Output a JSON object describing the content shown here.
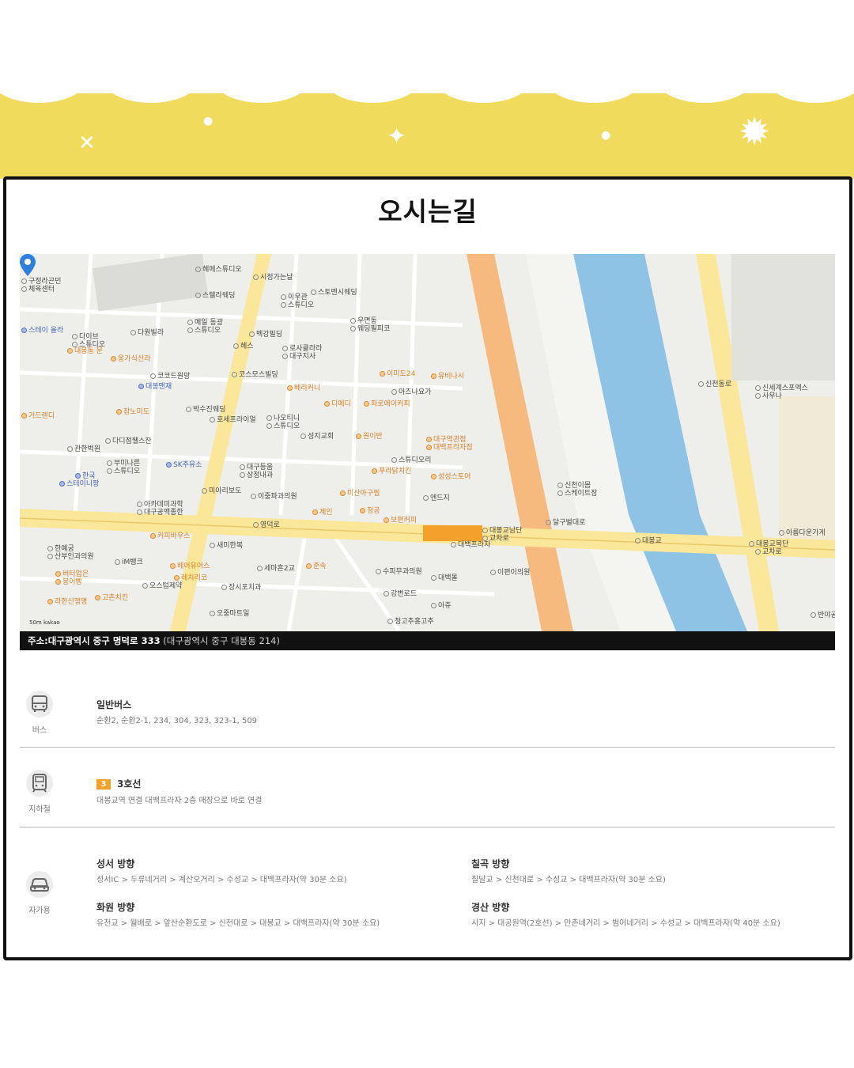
{
  "page": {
    "title": "오시는길"
  },
  "map": {
    "labels": [
      {
        "t": "구정라곤민",
        "c": "g"
      },
      {
        "t": "체육센터",
        "c": "g"
      },
      {
        "t": "스테이 올라",
        "c": "b"
      },
      {
        "t": "다이브",
        "c": "g"
      },
      {
        "t": "스튜디오",
        "c": "g"
      },
      {
        "t": "다원빌라",
        "c": "g"
      },
      {
        "t": "대봉동 문",
        "c": "o"
      },
      {
        "t": "옹가식신라",
        "c": "o"
      },
      {
        "t": "코코드원망",
        "c": "g"
      },
      {
        "t": "대봉맨재",
        "c": "b"
      },
      {
        "t": "거드렌디",
        "c": "o"
      },
      {
        "t": "잠노미도",
        "c": "o"
      },
      {
        "t": "헤메스튜디오",
        "c": "g"
      },
      {
        "t": "스텔라웨딩",
        "c": "g"
      },
      {
        "t": "메일 동광",
        "c": "g"
      },
      {
        "t": "스튜디오",
        "c": "g"
      },
      {
        "t": "벡강필딩",
        "c": "g"
      },
      {
        "t": "시정가는날",
        "c": "g"
      },
      {
        "t": "이우관",
        "c": "g"
      },
      {
        "t": "스튜디오",
        "c": "g"
      },
      {
        "t": "스토멘시웨딩",
        "c": "g"
      },
      {
        "t": "우면동",
        "c": "g"
      },
      {
        "t": "웨딩필피코",
        "c": "g"
      },
      {
        "t": "헤스",
        "c": "g"
      },
      {
        "t": "로사클라라",
        "c": "g"
      },
      {
        "t": "대구지사",
        "c": "g"
      },
      {
        "t": "코스모스빌딩",
        "c": "g"
      },
      {
        "t": "이미도24",
        "c": "o"
      },
      {
        "t": "유비나시",
        "c": "o"
      },
      {
        "t": "베리커니",
        "c": "o"
      },
      {
        "t": "아즈나요가",
        "c": "g"
      },
      {
        "t": "디에디",
        "c": "o"
      },
      {
        "t": "파로에이커피",
        "c": "o"
      },
      {
        "t": "박수진웨딩",
        "c": "g"
      },
      {
        "t": "호세프라이얼",
        "c": "g"
      },
      {
        "t": "나오티니",
        "c": "g"
      },
      {
        "t": "스튜디오",
        "c": "g"
      },
      {
        "t": "관한벅원",
        "c": "g"
      },
      {
        "t": "다디점웰스잔",
        "c": "g"
      },
      {
        "t": "SK주유소",
        "c": "b"
      },
      {
        "t": "부미나른",
        "c": "g"
      },
      {
        "t": "스튜디오",
        "c": "g"
      },
      {
        "t": "한국",
        "c": "b"
      },
      {
        "t": "스테이니팡",
        "c": "b"
      },
      {
        "t": "성지교회",
        "c": "g"
      },
      {
        "t": "원이반",
        "c": "o"
      },
      {
        "t": "대구역관점",
        "c": "o"
      },
      {
        "t": "대백프라자점",
        "c": "o"
      },
      {
        "t": "스튜디오리",
        "c": "g"
      },
      {
        "t": "푸라닭치킨",
        "c": "o"
      },
      {
        "t": "성성스토어",
        "c": "o"
      },
      {
        "t": "대구등움",
        "c": "g"
      },
      {
        "t": "상정내과",
        "c": "g"
      },
      {
        "t": "미아리보도",
        "c": "g"
      },
      {
        "t": "이중파과의원",
        "c": "g"
      },
      {
        "t": "미산아구찜",
        "c": "o"
      },
      {
        "t": "엔드지",
        "c": "g"
      },
      {
        "t": "아카데미과학",
        "c": "g"
      },
      {
        "t": "대구공맥종한",
        "c": "g"
      },
      {
        "t": "제인",
        "c": "o"
      },
      {
        "t": "청공",
        "c": "o"
      },
      {
        "t": "보편커피",
        "c": "o"
      },
      {
        "t": "신천이몸",
        "c": "g"
      },
      {
        "t": "스케이트장",
        "c": "g"
      },
      {
        "t": "대봉교남단",
        "c": "g"
      },
      {
        "t": "교차로",
        "c": "g"
      },
      {
        "t": "커피바우스",
        "c": "o"
      },
      {
        "t": "새미한복",
        "c": "g"
      },
      {
        "t": "한예궁",
        "c": "g"
      },
      {
        "t": "산부인과의원",
        "c": "g"
      },
      {
        "t": "iM뱅크",
        "c": "g"
      },
      {
        "t": "헤어유어스",
        "c": "o"
      },
      {
        "t": "세마흔2교",
        "c": "g"
      },
      {
        "t": "준속",
        "c": "o"
      },
      {
        "t": "버터업은",
        "c": "o"
      },
      {
        "t": "붕어빵",
        "c": "o"
      },
      {
        "t": "레치리코",
        "c": "o"
      },
      {
        "t": "수피무과의원",
        "c": "g"
      },
      {
        "t": "대백몰",
        "c": "g"
      },
      {
        "t": "이편이의원",
        "c": "g"
      },
      {
        "t": "라한신행명",
        "c": "o"
      },
      {
        "t": "고촌치킨",
        "c": "o"
      },
      {
        "t": "오스텀제약",
        "c": "g"
      },
      {
        "t": "장시포치과",
        "c": "g"
      },
      {
        "t": "강변로드",
        "c": "g"
      },
      {
        "t": "아쥬",
        "c": "g"
      },
      {
        "t": "오중마트일",
        "c": "g"
      },
      {
        "t": "청고추홍고추",
        "c": "g"
      },
      {
        "t": "신세계스포엑스",
        "c": "g"
      },
      {
        "t": "사우나",
        "c": "g"
      },
      {
        "t": "아름다운가게",
        "c": "g"
      },
      {
        "t": "대봉교북단",
        "c": "g"
      },
      {
        "t": "교차로",
        "c": "g"
      },
      {
        "t": "반야공",
        "c": "g"
      },
      {
        "t": "대봉교",
        "c": "g"
      },
      {
        "t": "대백프라자",
        "c": "g"
      },
      {
        "t": "신천동로",
        "c": "g"
      },
      {
        "t": "달구벌대로",
        "c": "g"
      },
      {
        "t": "영덕로",
        "c": "g"
      }
    ],
    "scale_text": "50m  kakao"
  },
  "address": {
    "label": "주소:",
    "main": "대구광역시 중구 명덕로 333",
    "sub": "(대구광역시 중구 대봉동 214)"
  },
  "transport": {
    "bus": {
      "icon": "bus-icon",
      "caption": "버스",
      "title": "일반버스",
      "text": "순환2, 순환2-1, 234, 304, 323, 323-1, 509"
    },
    "subway": {
      "icon": "subway-icon",
      "caption": "지하철",
      "line_number": "3",
      "title": "3호선",
      "text": "대봉교역 연결 대백프라자 2층 매장으로 바로 연결"
    },
    "car": {
      "icon": "car-icon",
      "caption": "자가용",
      "routes": [
        {
          "title": "성서 방향",
          "text": "성서IC > 두류네거리 > 계산오거리 > 수성교 > 대백프라자(약 30분 소요)"
        },
        {
          "title": "칠곡 방향",
          "text": "칠달교 > 신천대로 > 수성교 > 대백프라자(약 30분 소요)"
        },
        {
          "title": "화원 방향",
          "text": "유천교 > 월배로 > 앞산순환도로 > 신천대로 > 대봉교 > 대백프라자(약 30분 소요)"
        },
        {
          "title": "경산 방향",
          "text": "시지 > 대공원역(2호선) > 만촌네거리 > 범어네거리 > 수성교 > 대백프라자(약 40분 소요)"
        }
      ]
    }
  },
  "colors": {
    "banner_yellow": "#f1db5d",
    "frame_black": "#111111",
    "river_blue": "#8ec3e6",
    "main_road_orange": "#f7ba7e",
    "road_yellow": "#fbe79a",
    "subway_badge": "#f3a12b",
    "pin_blue": "#2f7fe0"
  }
}
